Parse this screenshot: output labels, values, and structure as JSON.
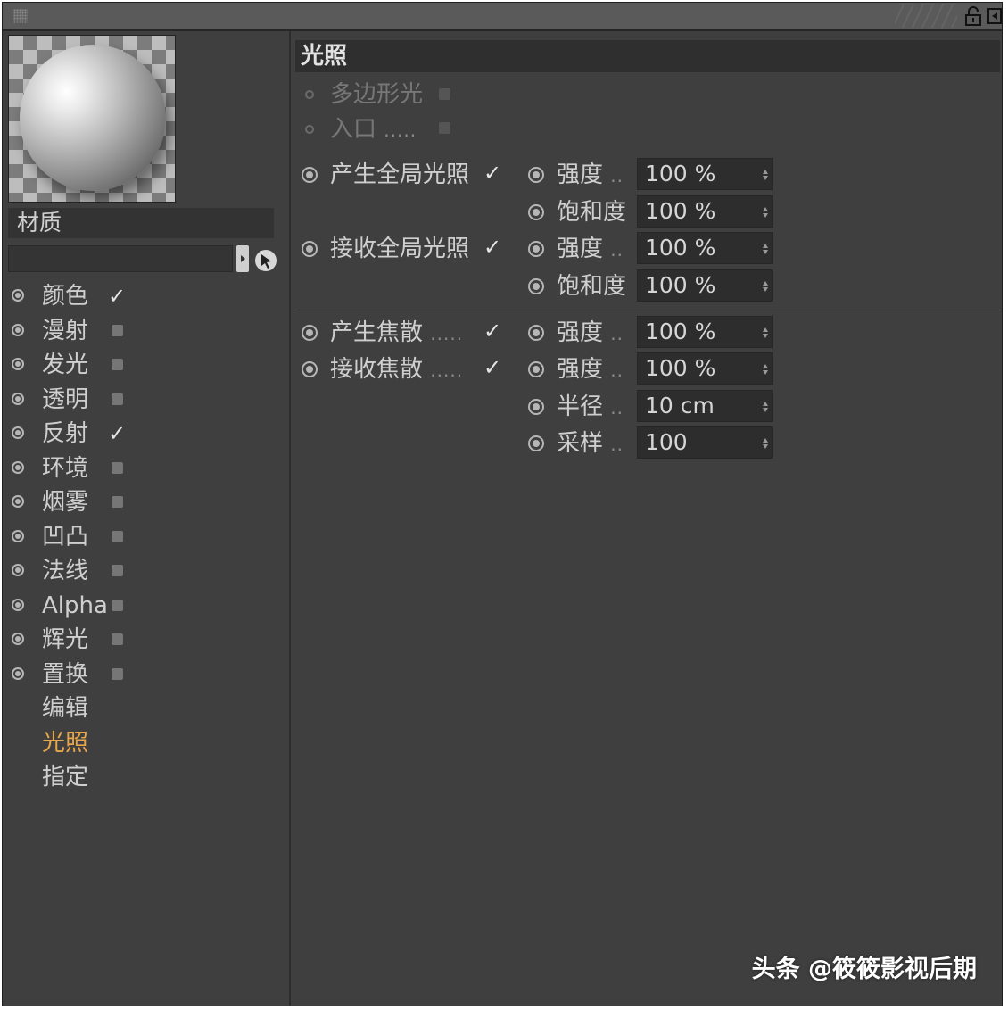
{
  "left": {
    "material_label": "材质",
    "channels": [
      {
        "label": "颜色",
        "checked": true
      },
      {
        "label": "漫射",
        "checked": false
      },
      {
        "label": "发光",
        "checked": false
      },
      {
        "label": "透明",
        "checked": false
      },
      {
        "label": "反射",
        "checked": true
      },
      {
        "label": "环境",
        "checked": false
      },
      {
        "label": "烟雾",
        "checked": false
      },
      {
        "label": "凹凸",
        "checked": false
      },
      {
        "label": "法线",
        "checked": false
      },
      {
        "label": "Alpha",
        "checked": false
      },
      {
        "label": "辉光",
        "checked": false
      },
      {
        "label": "置换",
        "checked": false
      }
    ],
    "menu": [
      {
        "label": "编辑",
        "active": false
      },
      {
        "label": "光照",
        "active": true
      },
      {
        "label": "指定",
        "active": false
      }
    ]
  },
  "right": {
    "section_title": "光照",
    "polygon_light": "多边形光",
    "portal": "入口",
    "portal_dots": ".....",
    "gi_generate": "产生全局光照",
    "gi_receive": "接收全局光照",
    "caustic_generate": "产生焦散",
    "caustic_receive": "接收焦散",
    "caustic_dots": ".....",
    "check_mark": "✓",
    "param_dots": "..",
    "strength": "强度",
    "saturation": "饱和度",
    "radius": "半径",
    "samples": "采样",
    "values": {
      "gi_gen_strength": "100 %",
      "gi_gen_saturation": "100 %",
      "gi_rec_strength": "100 %",
      "gi_rec_saturation": "100 %",
      "ca_gen_strength": "100 %",
      "ca_rec_strength": "100 %",
      "ca_radius": "10 cm",
      "ca_samples": "100"
    }
  },
  "watermark": "头条 @筱筱影视后期",
  "colors": {
    "active_menu": "#e7a64a",
    "panel_bg": "#3f3f3f"
  }
}
